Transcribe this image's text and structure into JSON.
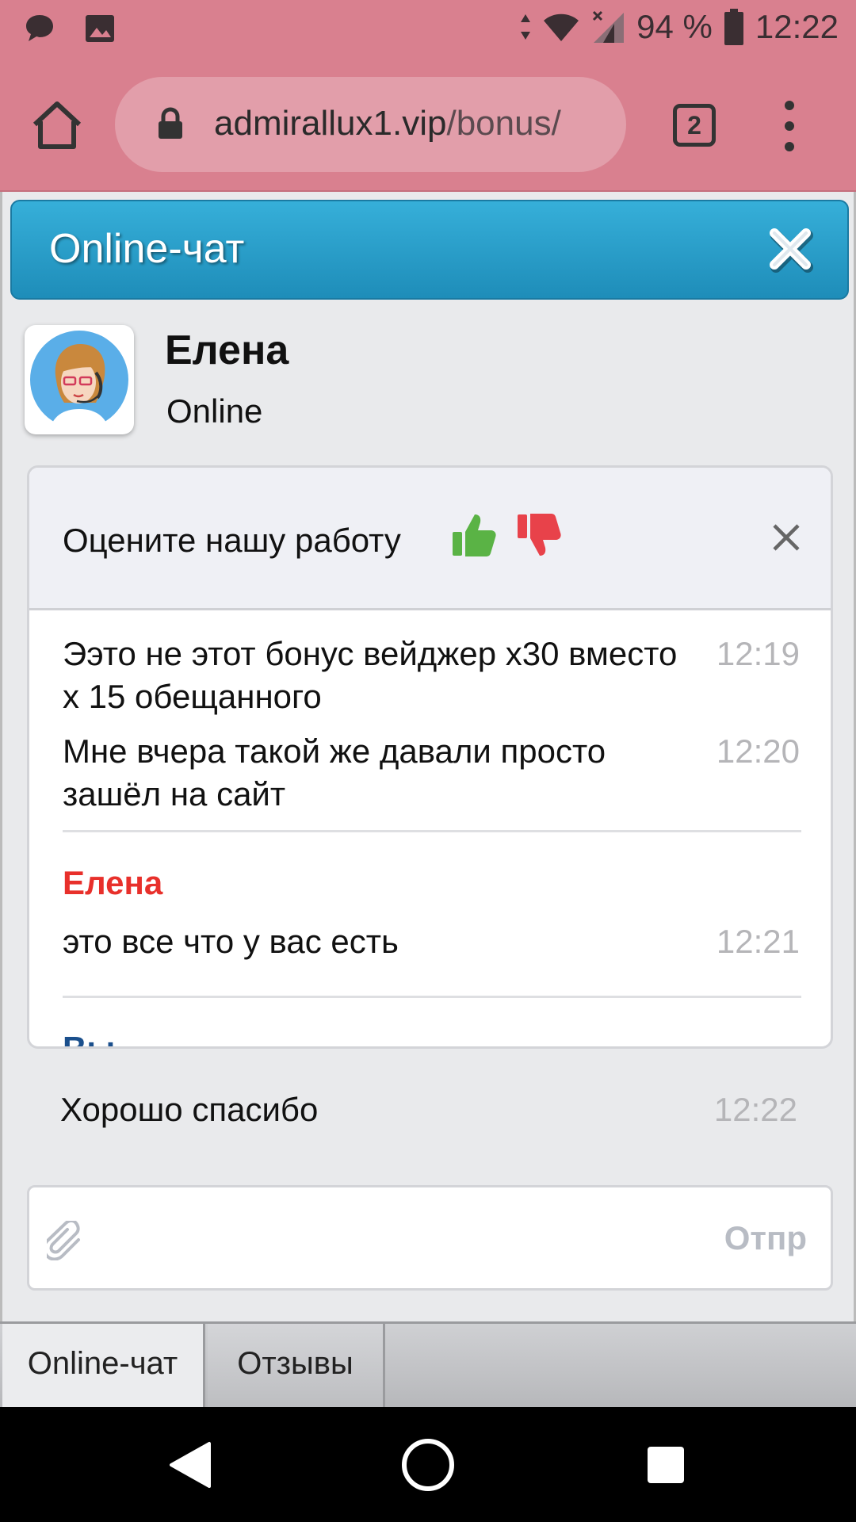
{
  "status_bar": {
    "battery": "94 %",
    "time": "12:22"
  },
  "browser": {
    "url_host": "admirallux1.vip",
    "url_path": "/bonus/",
    "tab_count": "2"
  },
  "chat": {
    "title": "Online-чат",
    "agent": {
      "name": "Елена",
      "status": "Online"
    },
    "rating_prompt": "Оцените нашу работу",
    "messages_user_1": [
      {
        "text": "Ээто не этот бонус вейджер х30 вместо х 15 обещанного",
        "time": "12:19"
      },
      {
        "text": "Мне вчера такой же давали просто зашёл на сайт",
        "time": "12:20"
      }
    ],
    "agent_sender": "Елена",
    "agent_message": {
      "text": "это все что у вас есть",
      "time": "12:21"
    },
    "user_sender": "Вы",
    "user_message": {
      "text": "Хорошо спасибо",
      "time": "12:22"
    },
    "send_label": "Отпр"
  },
  "bottom_tabs": {
    "chat": "Online-чат",
    "reviews": "Отзывы"
  },
  "colors": {
    "browser_bar": "#d9808f",
    "chat_header": "#2a9ccb",
    "agent_sender": "#e8302b",
    "user_sender": "#1a4f8c",
    "thumb_up": "#5ab345",
    "thumb_down": "#e8424a"
  }
}
